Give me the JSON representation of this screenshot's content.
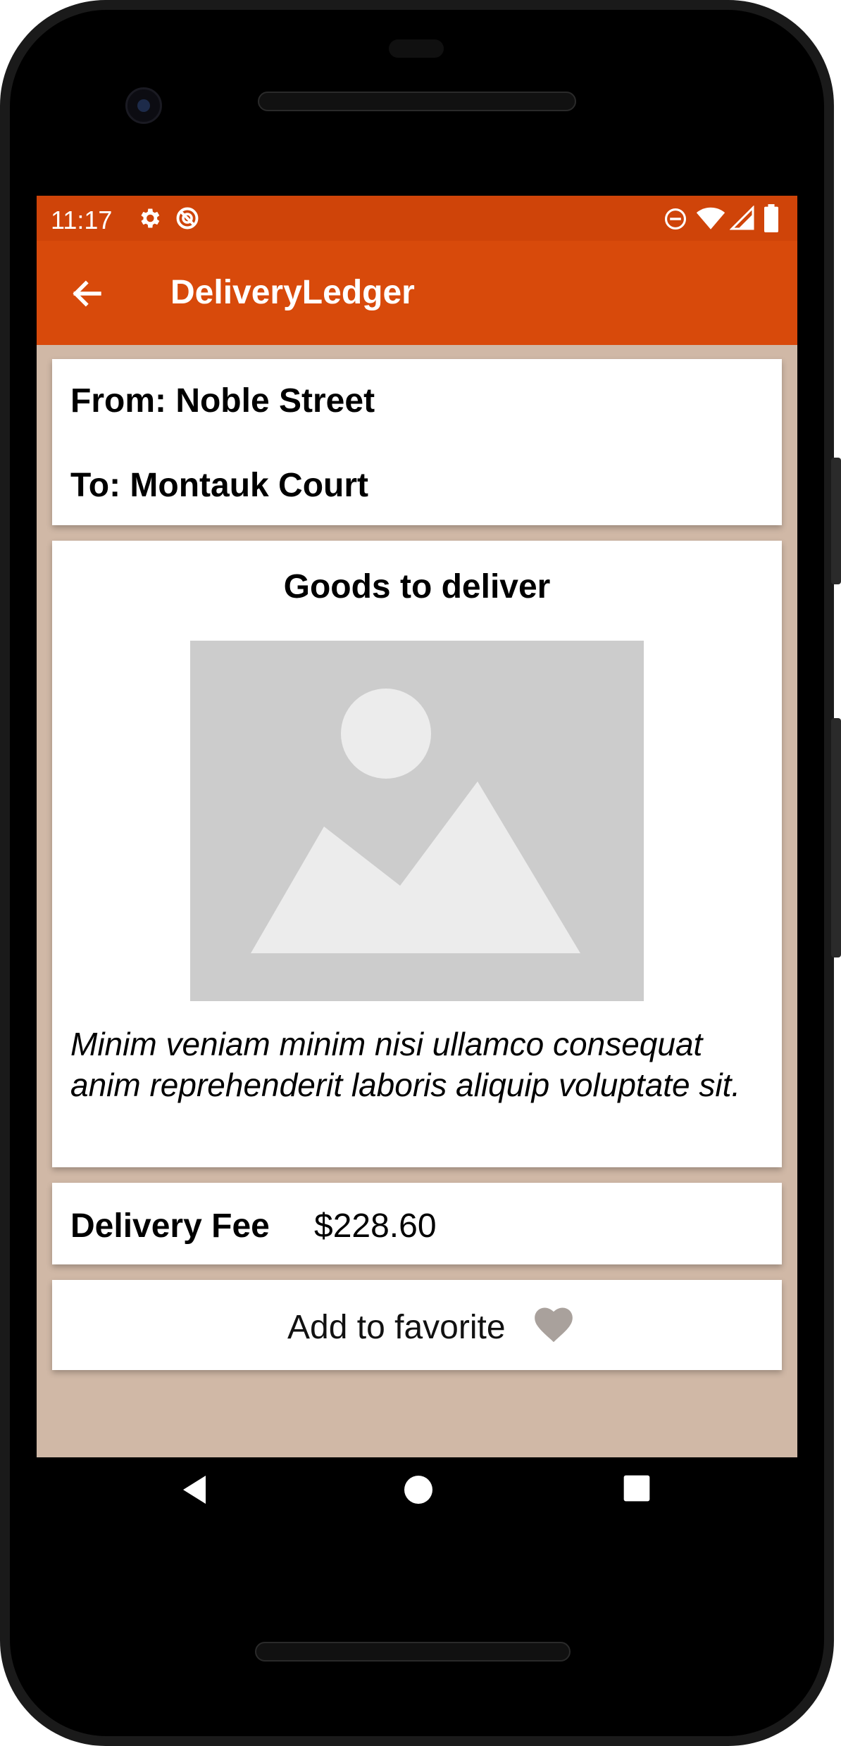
{
  "status_bar": {
    "time": "11:17",
    "icons_left": [
      "settings-icon",
      "sync-disabled-icon"
    ],
    "icons_right": [
      "do-not-disturb-icon",
      "wifi-icon",
      "signal-icon",
      "battery-icon"
    ]
  },
  "app_bar": {
    "title": "DeliveryLedger",
    "back_icon": "arrow-left-icon",
    "color": "#d84a0b"
  },
  "route": {
    "from": "From: Noble Street",
    "to": "To: Montauk Court"
  },
  "goods": {
    "title": "Goods to deliver",
    "image_icon": "image-placeholder-icon",
    "description": "Minim veniam minim nisi ullamco consequat anim reprehenderit laboris aliquip voluptate sit."
  },
  "fee": {
    "label": "Delivery Fee",
    "value": "$228.60"
  },
  "favorite": {
    "label": "Add to favorite",
    "icon": "heart-icon",
    "icon_color": "#a9a19c"
  },
  "nav_bar": {
    "icons": [
      "back-triangle-icon",
      "home-circle-icon",
      "recents-square-icon"
    ]
  },
  "colors": {
    "status_bar": "#cf4409",
    "background": "#d0b8a6",
    "card": "#ffffff"
  }
}
